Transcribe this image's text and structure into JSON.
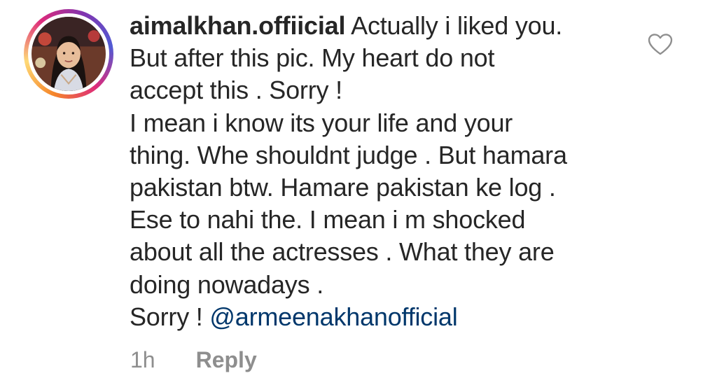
{
  "comment": {
    "username": "aimalkhan.offiicial",
    "avatar_icon": "user-avatar-photo",
    "lines": [
      " Actually i liked you.",
      "But after this pic. My heart do not",
      "accept this . Sorry !",
      "I mean i know its your life and your",
      "thing. Whe shouldnt judge . But hamara",
      "pakistan btw. Hamare pakistan ke log .",
      "Ese to nahi the. I mean i m shocked",
      "about all the actresses . What they are",
      "doing nowadays ."
    ],
    "last_line_prefix": "Sorry ! ",
    "mention": "@armeenakhanofficial",
    "timestamp": "1h",
    "reply_label": "Reply",
    "like_icon": "heart-outline-icon"
  },
  "colors": {
    "text": "#262626",
    "muted": "#8e8e8e",
    "mention": "#00376b"
  }
}
